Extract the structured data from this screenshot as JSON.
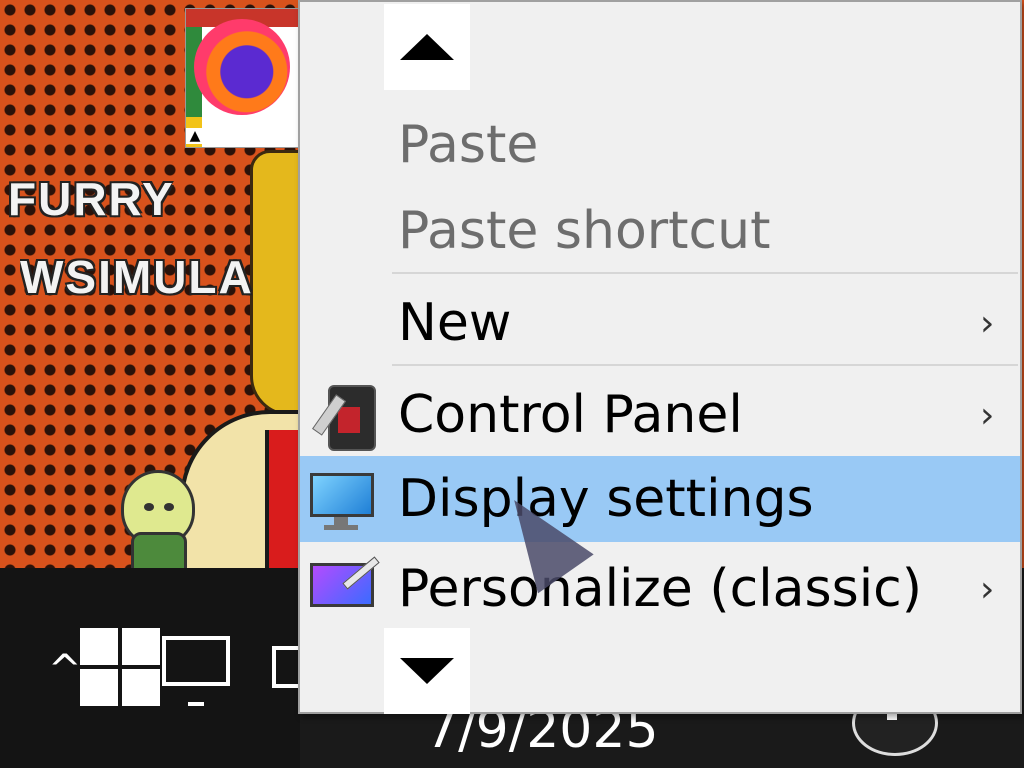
{
  "desktop": {
    "icon_name": "firefox-icon",
    "banner_line1": "FURRY",
    "banner_line2": "WSIMULA"
  },
  "taskbar": {
    "date": "7/9/2025"
  },
  "context_menu": {
    "scroll_up_icon": "triangle-up-icon",
    "scroll_down_icon": "triangle-down-icon",
    "items": [
      {
        "label": "Paste",
        "enabled": false,
        "submenu": false
      },
      {
        "label": "Paste shortcut",
        "enabled": false,
        "submenu": false
      },
      {
        "label": "New",
        "enabled": true,
        "submenu": true,
        "submenu_glyph": "›"
      },
      {
        "label": "Control Panel",
        "enabled": true,
        "submenu": true,
        "submenu_glyph": "›",
        "icon": "control-panel-icon"
      },
      {
        "label": "Display settings",
        "enabled": true,
        "submenu": false,
        "highlighted": true,
        "icon": "display-monitor-icon"
      },
      {
        "label": "Personalize (classic)",
        "enabled": true,
        "submenu": true,
        "submenu_glyph": "›",
        "icon": "personalize-monitor-icon"
      }
    ]
  },
  "colors": {
    "menu_background": "#f0f0f0",
    "highlight": "#99c9f5",
    "disabled_text": "#6d6d6d",
    "wallpaper_orange": "#d8521c"
  }
}
